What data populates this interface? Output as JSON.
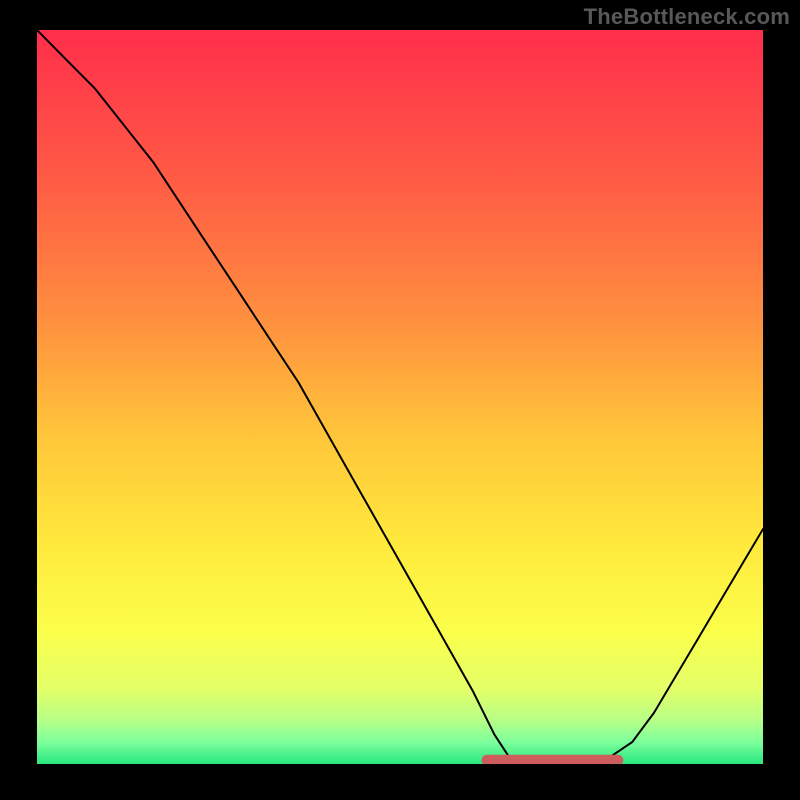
{
  "watermark": "TheBottleneck.com",
  "chart_data": {
    "type": "line",
    "title": "",
    "xlabel": "",
    "ylabel": "",
    "x_range": [
      0,
      100
    ],
    "y_range": [
      0,
      100
    ],
    "series": [
      {
        "name": "bottleneck-curve",
        "x": [
          0,
          4,
          8,
          12,
          16,
          20,
          24,
          28,
          32,
          36,
          40,
          44,
          48,
          52,
          56,
          60,
          63,
          65,
          67,
          70,
          73,
          76,
          79,
          82,
          85,
          88,
          91,
          94,
          97,
          100
        ],
        "y": [
          100,
          96,
          92,
          87,
          82,
          76,
          70,
          64,
          58,
          52,
          45,
          38,
          31,
          24,
          17,
          10,
          4,
          1,
          0,
          0,
          0,
          0,
          1,
          3,
          7,
          12,
          17,
          22,
          27,
          32
        ]
      }
    ],
    "bottom_band": {
      "x_start": 62,
      "x_end": 80,
      "y": 0.5
    },
    "background_gradient": {
      "stops": [
        {
          "offset": 0.0,
          "color": "#ff2e4b"
        },
        {
          "offset": 0.2,
          "color": "#ff5a45"
        },
        {
          "offset": 0.4,
          "color": "#ff913f"
        },
        {
          "offset": 0.55,
          "color": "#ffc53a"
        },
        {
          "offset": 0.7,
          "color": "#ffe93c"
        },
        {
          "offset": 0.82,
          "color": "#fbff4a"
        },
        {
          "offset": 0.9,
          "color": "#e2ff6a"
        },
        {
          "offset": 0.94,
          "color": "#b7ff86"
        },
        {
          "offset": 0.97,
          "color": "#7dff9c"
        },
        {
          "offset": 1.0,
          "color": "#28e77e"
        }
      ]
    }
  }
}
